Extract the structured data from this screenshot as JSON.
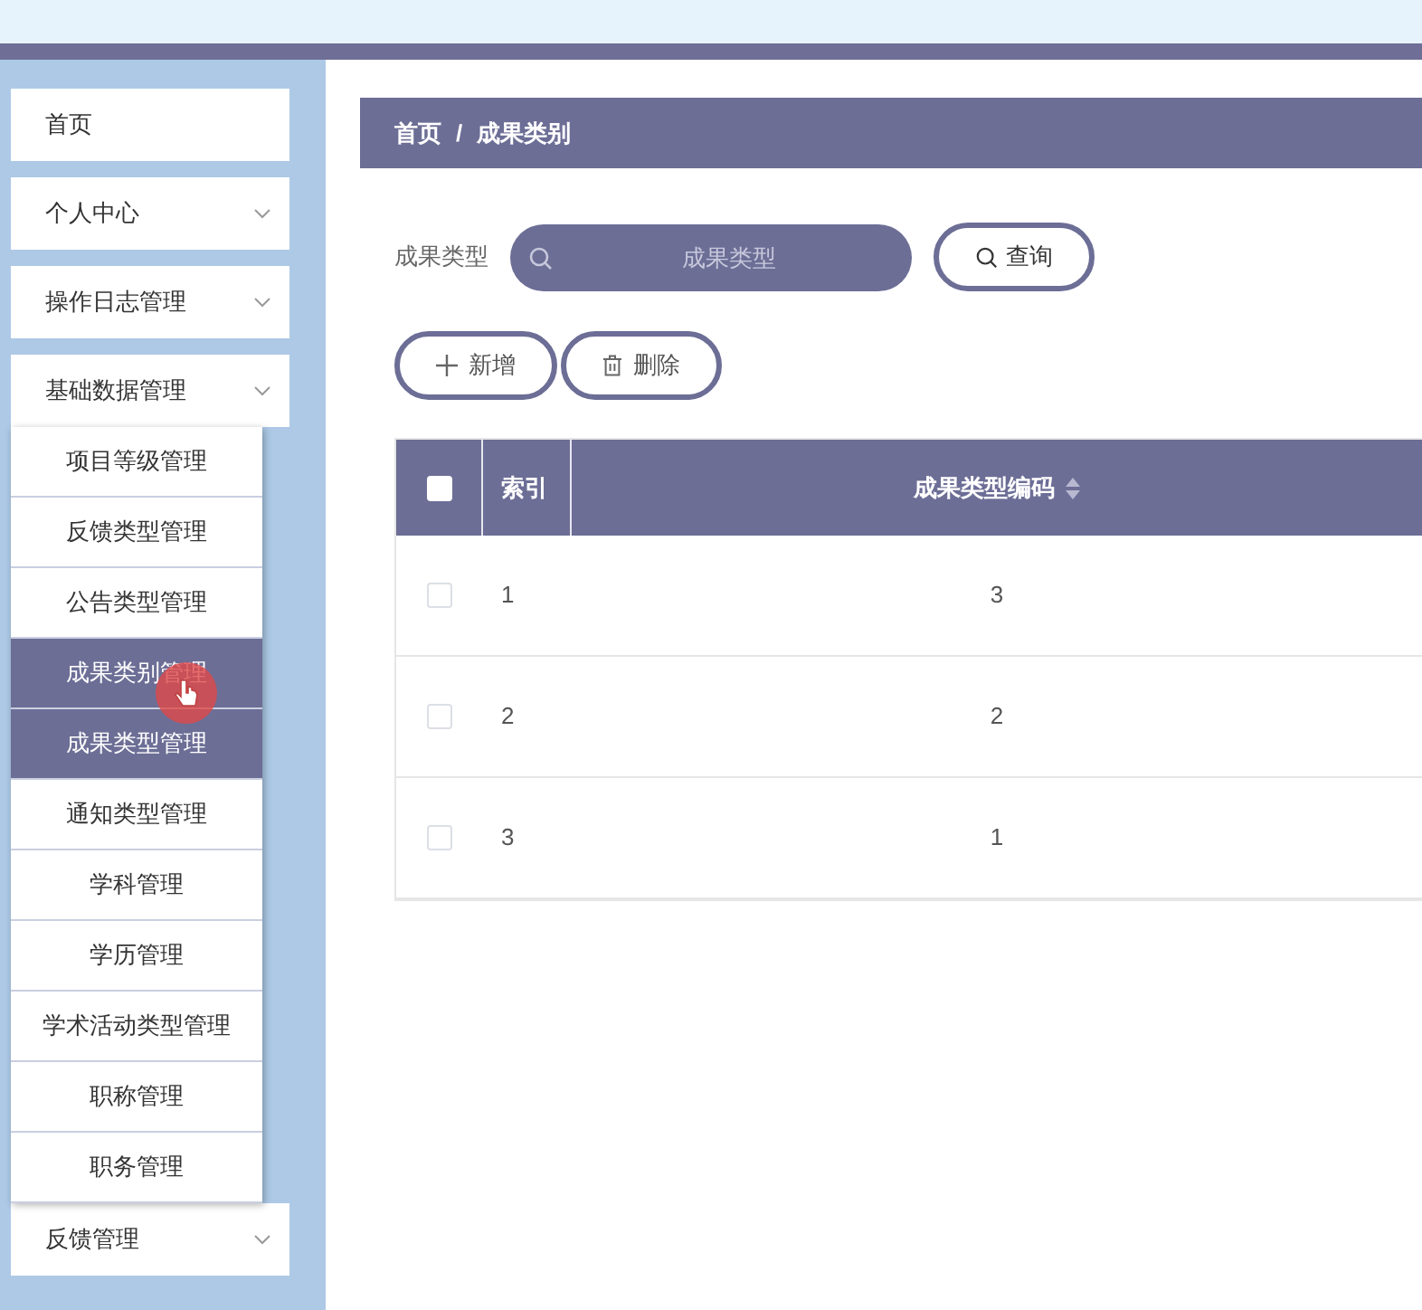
{
  "sidebar": {
    "items": [
      {
        "label": "首页",
        "kind": "link"
      },
      {
        "label": "个人中心",
        "kind": "group"
      },
      {
        "label": "操作日志管理",
        "kind": "group"
      },
      {
        "label": "基础数据管理",
        "kind": "group",
        "children": [
          {
            "label": "项目等级管理",
            "selected": false
          },
          {
            "label": "反馈类型管理",
            "selected": false
          },
          {
            "label": "公告类型管理",
            "selected": false
          },
          {
            "label": "成果类别管理",
            "selected": true
          },
          {
            "label": "成果类型管理",
            "selected": true
          },
          {
            "label": "通知类型管理",
            "selected": false
          },
          {
            "label": "学科管理",
            "selected": false
          },
          {
            "label": "学历管理",
            "selected": false
          },
          {
            "label": "学术活动类型管理",
            "selected": false
          },
          {
            "label": "职称管理",
            "selected": false
          },
          {
            "label": "职务管理",
            "selected": false
          }
        ]
      },
      {
        "label": "反馈管理",
        "kind": "group"
      }
    ]
  },
  "breadcrumb": [
    "首页",
    "/",
    "成果类别"
  ],
  "search": {
    "label": "成果类型",
    "placeholder": "成果类型",
    "button": "查询"
  },
  "actions": [
    "新增",
    "删除"
  ],
  "table": {
    "all_checked": false,
    "columns": [
      "索引",
      "成果类型编码"
    ],
    "rows": [
      {
        "index": "1",
        "code": "3",
        "checked": false
      },
      {
        "index": "2",
        "code": "2",
        "checked": false
      },
      {
        "index": "3",
        "code": "1",
        "checked": false
      }
    ]
  }
}
